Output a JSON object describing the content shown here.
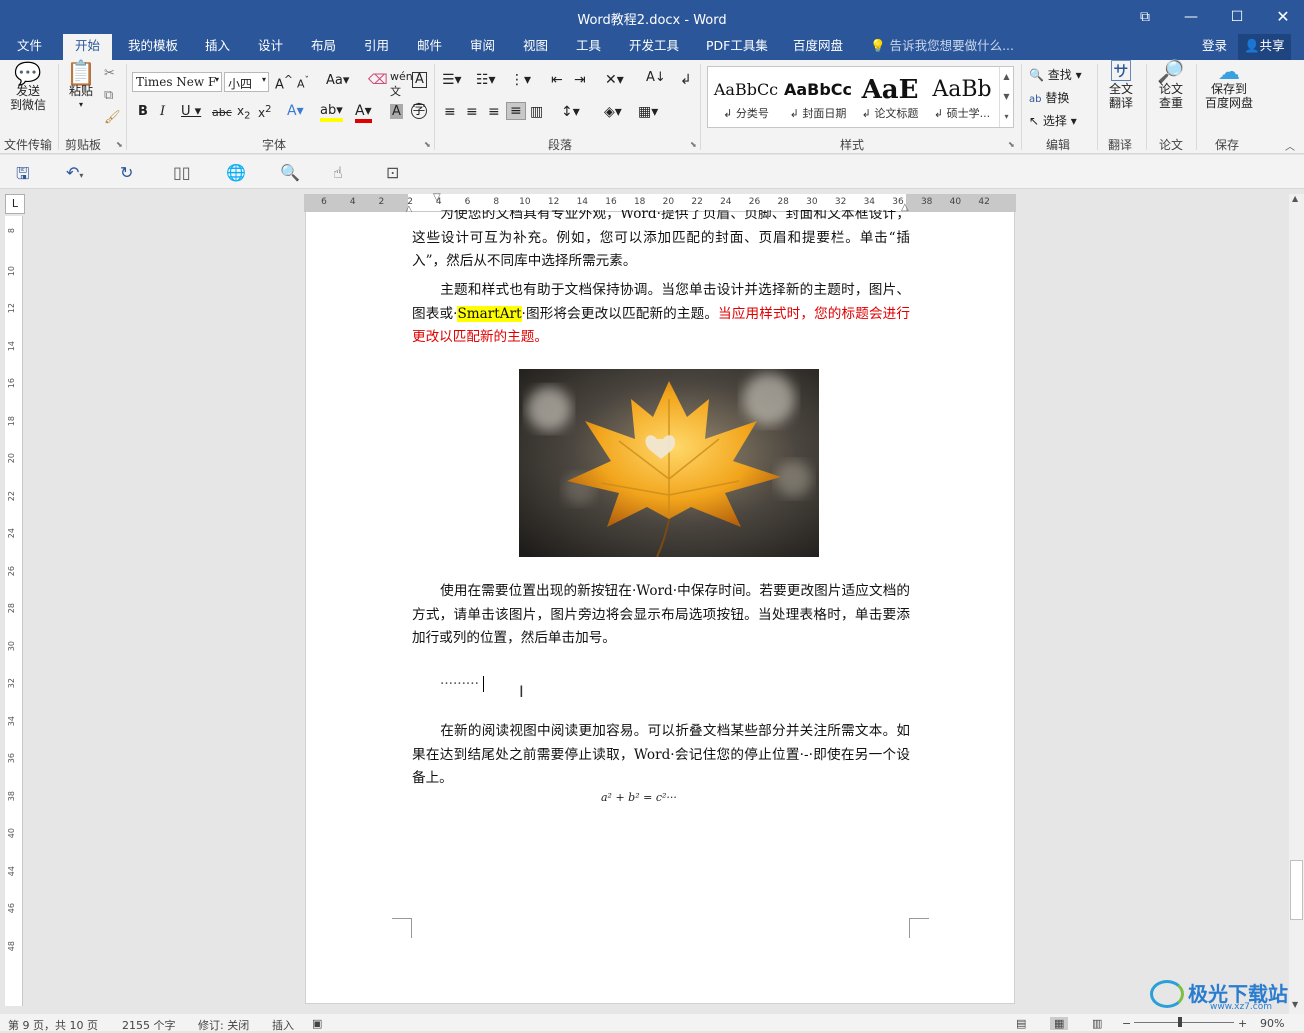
{
  "window": {
    "title": "Word教程2.docx - Word"
  },
  "menu": {
    "tabs": [
      "文件",
      "开始",
      "我的模板",
      "插入",
      "设计",
      "布局",
      "引用",
      "邮件",
      "审阅",
      "视图",
      "工具",
      "开发工具",
      "PDF工具集",
      "百度网盘"
    ],
    "active_tab": "开始",
    "tell_me": "告诉我您想要做什么...",
    "login": "登录",
    "share": "共享"
  },
  "ribbon": {
    "send_wechat": "发送\n到微信",
    "file_transfer": "文件传输",
    "paste": "粘贴",
    "clipboard": "剪贴板",
    "font_name": "Times New F",
    "font_size": "小四",
    "font_group": "字体",
    "para_group": "段落",
    "styles_group": "样式",
    "styles": [
      {
        "preview": "AaBbCc",
        "label": "分类号"
      },
      {
        "preview": "AaBbCc",
        "label": "封面日期"
      },
      {
        "preview": "AaE",
        "label": "论文标题"
      },
      {
        "preview": "AaBb",
        "label": "硕士学..."
      }
    ],
    "find": "查找",
    "replace": "替换",
    "select": "选择",
    "edit_group": "编辑",
    "full_translate": "全文\n翻译",
    "translate_group": "翻译",
    "paper_check": "论文\n查重",
    "paper_group": "论文",
    "save_baidu": "保存到\n百度网盘",
    "save_group": "保存"
  },
  "ruler": {
    "h_numbers": [
      "6",
      "4",
      "2",
      "2",
      "4",
      "6",
      "8",
      "10",
      "12",
      "14",
      "16",
      "18",
      "20",
      "22",
      "24",
      "26",
      "28",
      "30",
      "32",
      "34",
      "36",
      "38",
      "40",
      "42"
    ],
    "v_numbers": [
      "8",
      "10",
      "12",
      "14",
      "16",
      "18",
      "20",
      "22",
      "24",
      "26",
      "28",
      "30",
      "32",
      "34",
      "36",
      "38",
      "40",
      "44",
      "46",
      "48"
    ]
  },
  "document": {
    "p0": "为使您的文档具有专业外观，Word·提供了页眉、页脚、封面和文本框设计，这些设计可互为补充。例如，您可以添加匹配的封面、页眉和提要栏。单击“插入”，然后从不同库中选择所需元素。",
    "p1_a": "主题和样式也有助于文档保持协调。当您单击设计并选择新的主题时，图片、图表或·",
    "p1_hl": "SmartArt",
    "p1_b": "·图形将会更改以匹配新的主题。",
    "p1_red": "当应用样式时，您的标题会进行更改以匹配新的主题。",
    "p2": "使用在需要位置出现的新按钮在·Word·中保存时间。若要更改图片适应文档的方式，请单击该图片，图片旁边将会显示布局选项按钮。当处理表格时，单击要添加行或列的位置，然后单击加号。",
    "dots": "·········",
    "p3": "在新的阅读视图中阅读更加容易。可以折叠文档某些部分并关注所需文本。如果在达到结尾处之前需要停止读取，Word·会记住您的停止位置·-·即使在另一个设备上。",
    "formula": "a² + b² = c²···"
  },
  "status": {
    "page": "第 9 页，共 10 页",
    "words": "2155 个字",
    "revision": "修订: 关闭",
    "insert": "插入",
    "zoom": "90%"
  },
  "watermark": {
    "text": "极光下载站",
    "url": "www.xz7.com"
  },
  "colors": {
    "accent": "#2b579a",
    "highlight": "#ffff00",
    "red_text": "#e00000"
  }
}
